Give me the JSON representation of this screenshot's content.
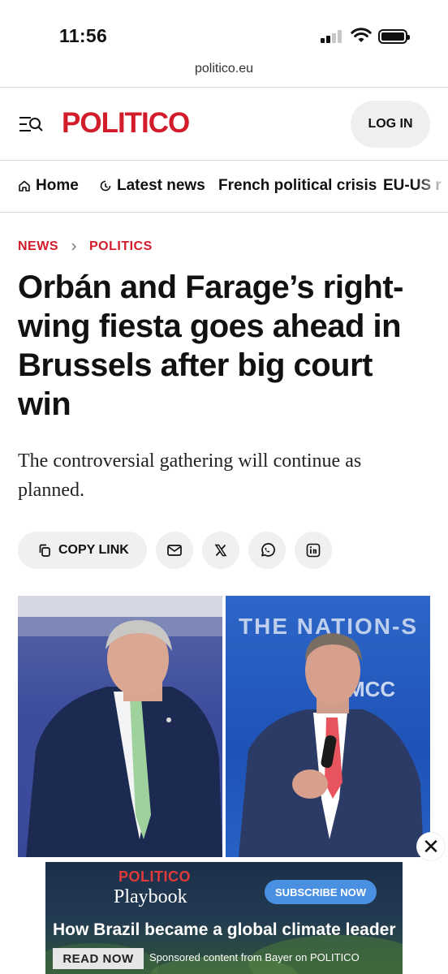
{
  "status_bar": {
    "time": "11:56"
  },
  "browser": {
    "url": "politico.eu"
  },
  "header": {
    "logo": "POLITICO",
    "login_label": "LOG IN"
  },
  "nav": {
    "items": [
      {
        "label": "Home",
        "icon": "home-icon"
      },
      {
        "label": "Latest news",
        "icon": "clock-icon"
      },
      {
        "label": "French political crisis"
      },
      {
        "label": "EU-US r"
      }
    ]
  },
  "breadcrumb": {
    "section": "NEWS",
    "subsection": "POLITICS"
  },
  "article": {
    "headline": "Orbán and Farage’s right-wing fiesta goes ahead in Brussels after big court win",
    "dek": "The controversial gathering will continue as planned."
  },
  "share": {
    "copy_link_label": "COPY LINK",
    "buttons": [
      "email-icon",
      "x-icon",
      "whatsapp-icon",
      "linkedin-icon"
    ]
  },
  "hero": {
    "right_backdrop_text": "THE NATION-S",
    "right_backdrop_logo": "MCC"
  },
  "ad": {
    "brand": "POLITICO",
    "product": "Playbook",
    "subscribe_label": "SUBSCRIBE NOW",
    "headline": "How Brazil became a global climate leader",
    "read_now_label": "READ NOW",
    "sponsored_text": "Sponsored content from Bayer on POLITICO",
    "close_label": "✕"
  },
  "colors": {
    "brand_red": "#d31c2a",
    "chip_bg": "#f0f0f0"
  }
}
